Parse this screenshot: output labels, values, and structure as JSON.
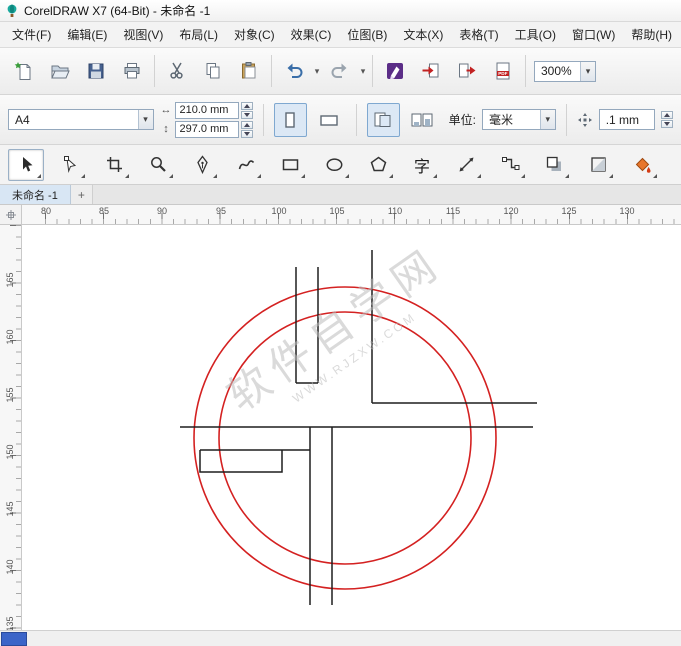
{
  "window": {
    "title": "CorelDRAW X7 (64-Bit) - 未命名 -1"
  },
  "menu": {
    "items": [
      "文件(F)",
      "编辑(E)",
      "视图(V)",
      "布局(L)",
      "对象(C)",
      "效果(C)",
      "位图(B)",
      "文本(X)",
      "表格(T)",
      "工具(O)",
      "窗口(W)",
      "帮助(H)"
    ]
  },
  "toolbar": {
    "zoom_value": "300%"
  },
  "property_bar": {
    "paper_size": "A4",
    "width_value": "210.0 mm",
    "height_value": "297.0 mm",
    "units_label": "单位:",
    "units_value": "毫米",
    "nudge_value": ".1 mm"
  },
  "toolbox": {
    "text_tool_glyph": "字"
  },
  "tabs": {
    "active_label": "未命名 -1",
    "new_tab_label": "+"
  },
  "rulers": {
    "horizontal": [
      "80",
      "85",
      "90",
      "95",
      "100",
      "105",
      "110",
      "115",
      "120",
      "125",
      "130"
    ],
    "vertical": [
      "165",
      "160",
      "155",
      "150",
      "145",
      "140",
      "135"
    ]
  },
  "canvas": {
    "watermark_line1": "软件自学网",
    "watermark_line2": "WWW.RJZXW.COM"
  },
  "colors": {
    "circle_stroke": "#d42121",
    "line_stroke": "#1f1f1f",
    "tab_accent": "#d8e6f4",
    "navigator_blue": "#3b64c8"
  },
  "icons": {
    "app-logo-icon": "teal hot-air balloon",
    "new-document-icon": "page with green star",
    "open-icon": "folder",
    "save-icon": "blue floppy disk",
    "print-icon": "printer",
    "cut-icon": "scissors",
    "copy-icon": "two pages",
    "paste-icon": "clipboard",
    "undo-icon": "curved arrow left",
    "redo-icon": "curved arrow right",
    "launcher-icon": "purple square with pen",
    "import-icon": "page with red inward arrow",
    "export-icon": "page with red outward arrow",
    "pdf-icon": "page with PDF label",
    "portrait-icon": "tall rectangle",
    "landscape-icon": "wide rectangle",
    "all-pages-icon": "stacked pages",
    "facing-pages-icon": "page pair bars",
    "nudge-icon": "four-way arrows",
    "pick-tool-icon": "cursor arrow",
    "shape-tool-icon": "outline arrow with node",
    "crop-tool-icon": "crop corners",
    "zoom-tool-icon": "magnifier",
    "freehand-tool-icon": "pen nib",
    "artistic-media-tool-icon": "calligraphic curve",
    "rectangle-tool-icon": "rectangle",
    "ellipse-tool-icon": "ellipse",
    "polygon-tool-icon": "polygon",
    "text-tool-icon": "CJK character",
    "dimension-tool-icon": "diagonal double arrow",
    "connector-tool-icon": "elbow connector",
    "drop-shadow-tool-icon": "offset squares",
    "transparency-tool-icon": "fading square",
    "fill-tool-icon": "orange paint shape",
    "ruler-origin-icon": "crosshair"
  }
}
